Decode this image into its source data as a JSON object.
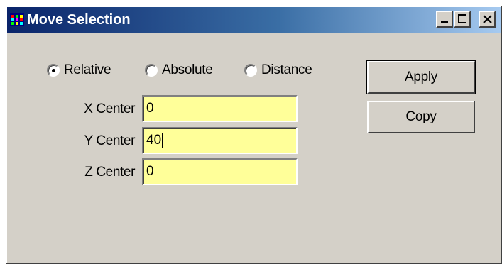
{
  "window": {
    "title": "Move Selection",
    "icon": "app-grid-icon",
    "title_colors": {
      "start": "#0a246a",
      "end": "#a6caf0"
    }
  },
  "title_buttons": {
    "minimize_icon": "minimize-icon",
    "maximize_icon": "maximize-icon",
    "close_icon": "close-icon"
  },
  "mode": {
    "selected": "Relative",
    "options": [
      {
        "label": "Relative",
        "checked": true
      },
      {
        "label": "Absolute",
        "checked": false
      },
      {
        "label": "Distance",
        "checked": false
      }
    ]
  },
  "fields": [
    {
      "label": "X Center",
      "value": "0"
    },
    {
      "label": "Y Center",
      "value": "40"
    },
    {
      "label": "Z Center",
      "value": "0"
    }
  ],
  "buttons": {
    "apply": "Apply",
    "copy": "Copy"
  },
  "colors": {
    "field_background": "#ffff99",
    "dialog_background": "#d4d0c8"
  }
}
